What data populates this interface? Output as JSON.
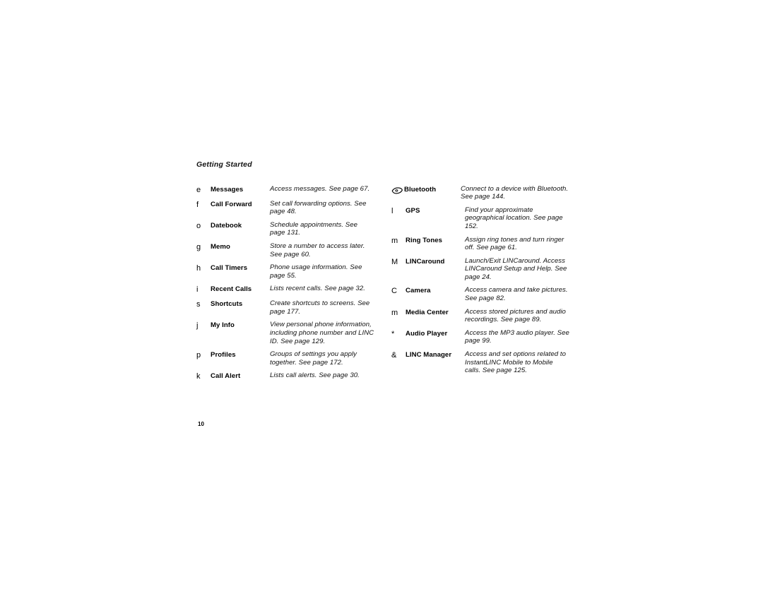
{
  "document": {
    "header": "Getting Started",
    "page_number": "10"
  },
  "columns": {
    "left": [
      {
        "glyph": "e",
        "icon_name": "messages-icon",
        "name": "Messages",
        "description": "Access messages. See page 67."
      },
      {
        "glyph": "f",
        "icon_name": "call-forward-icon",
        "name": "Call Forward",
        "description": "Set call forwarding options. See page 48."
      },
      {
        "glyph": "o",
        "icon_name": "datebook-icon",
        "name": "Datebook",
        "description": "Schedule appointments. See page 131."
      },
      {
        "glyph": "g",
        "icon_name": "memo-icon",
        "name": "Memo",
        "description": "Store a number to access later. See page 60."
      },
      {
        "glyph": "h",
        "icon_name": "call-timers-icon",
        "name": "Call Timers",
        "description": "Phone usage information. See page 55."
      },
      {
        "glyph": "i",
        "icon_name": "recent-calls-icon",
        "name": "Recent Calls",
        "description": "Lists recent calls. See page 32."
      },
      {
        "glyph": "s",
        "icon_name": "shortcuts-icon",
        "name": "Shortcuts",
        "description": "Create shortcuts to screens. See page 177."
      },
      {
        "glyph": "j",
        "icon_name": "my-info-icon",
        "name": "My Info",
        "description": "View personal phone information, including phone number and LINC ID. See page 129."
      },
      {
        "glyph": "p",
        "icon_name": "profiles-icon",
        "name": "Profiles",
        "description": "Groups of settings you apply together. See page 172."
      },
      {
        "glyph": "k",
        "icon_name": "call-alert-icon",
        "name": "Call Alert",
        "description": "Lists call alerts. See page 30."
      }
    ],
    "right": [
      {
        "glyph": "",
        "icon_name": "bluetooth-icon",
        "name": "Bluetooth",
        "description": "Connect to a device with Bluetooth. See page 144."
      },
      {
        "glyph": "l",
        "icon_name": "gps-icon",
        "name": "GPS",
        "description": "Find your approximate geographical location. See page 152."
      },
      {
        "glyph": "m",
        "icon_name": "ring-tones-icon",
        "name": "Ring Tones",
        "description": "Assign ring tones and turn ringer off. See page 61."
      },
      {
        "glyph": "M",
        "icon_name": "lincaround-icon",
        "name": "LINCaround",
        "description": "Launch/Exit LINCaround. Access LINCaround Setup and Help. See page 24."
      },
      {
        "glyph": "C",
        "icon_name": "camera-icon",
        "name": "Camera",
        "description": "Access camera and take pictures. See page 82."
      },
      {
        "glyph": "m",
        "icon_name": "media-center-icon",
        "name": "Media Center",
        "description": "Access stored pictures and audio recordings. See page 89."
      },
      {
        "glyph": "*",
        "icon_name": "audio-player-icon",
        "name": "Audio Player",
        "description": "Access the MP3 audio player. See page 99."
      },
      {
        "glyph": "&",
        "icon_name": "linc-manager-icon",
        "name": "LINC Manager",
        "description": "Access and set options related to InstantLINC Mobile to Mobile calls. See page 125."
      }
    ]
  }
}
